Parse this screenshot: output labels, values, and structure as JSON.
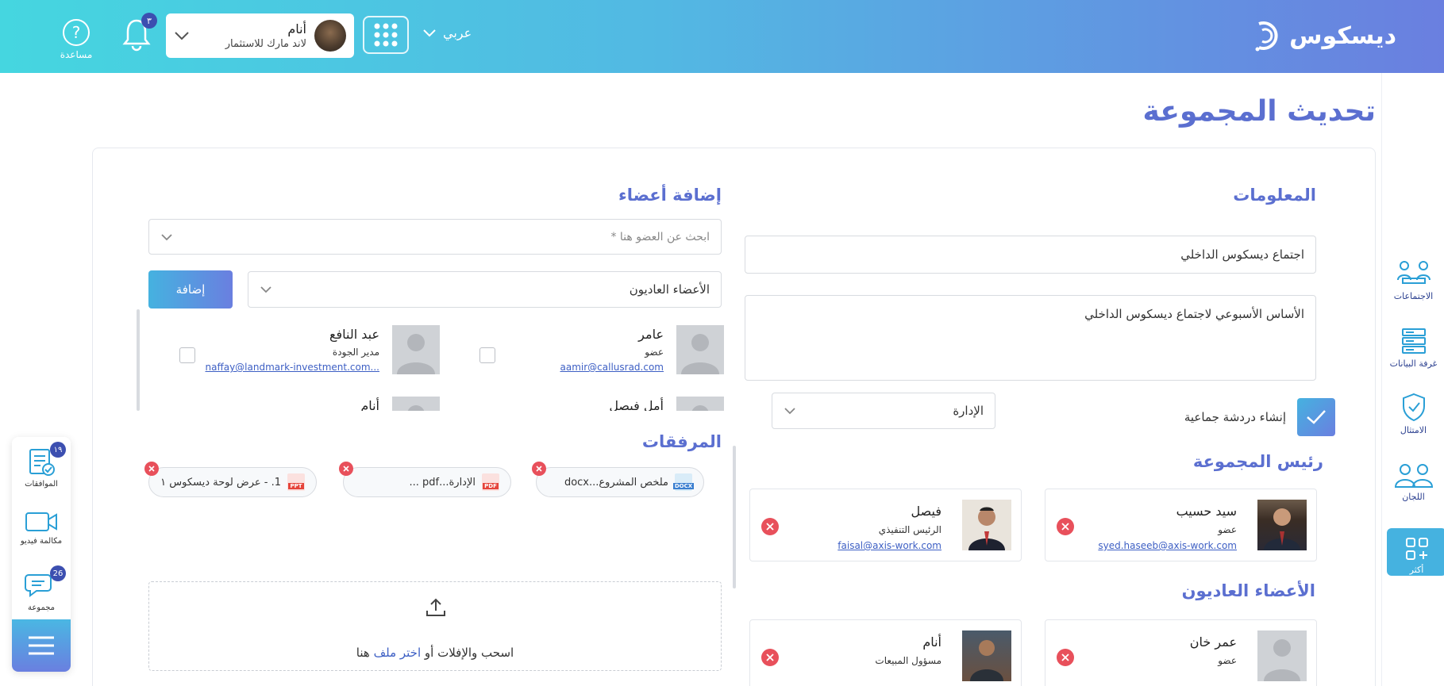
{
  "header": {
    "logo_text": "ديسكوس",
    "language": "عربي",
    "user": {
      "name": "أنام",
      "company": "لاند مارك للاستثمار"
    },
    "notifications_count": "٣",
    "help_label": "مساعدة"
  },
  "right_sidebar": {
    "items": [
      {
        "label": "الاجتماعات",
        "icon": "meetings-icon"
      },
      {
        "label": "غرفة البيانات",
        "icon": "data-room-icon"
      },
      {
        "label": "الامتثال",
        "icon": "compliance-shield-icon"
      },
      {
        "label": "اللجان",
        "icon": "committees-icon"
      },
      {
        "label": "أكثر",
        "icon": "more-grid-icon"
      }
    ]
  },
  "left_panel": {
    "items": [
      {
        "label": "الموافقات",
        "badge": "١٩",
        "icon": "approvals-icon"
      },
      {
        "label": "مكالمة فيديو",
        "icon": "video-call-icon"
      },
      {
        "label": "مجموعة",
        "badge": "26",
        "icon": "group-chat-icon"
      }
    ]
  },
  "page": {
    "title": "تحديث المجموعة"
  },
  "info_section": {
    "title": "المعلومات",
    "group_name": "اجتماع ديسكوس الداخلي",
    "description": "الأساس الأسبوعي لاجتماع ديسكوس الداخلي",
    "create_chat_label": "إنشاء دردشة جماعية",
    "create_chat_checked": true,
    "department_select": "الإدارة"
  },
  "group_head": {
    "title": "رئيس المجموعة",
    "members": [
      {
        "name": "سيد حسيب",
        "role": "عضو",
        "email": "syed.haseeb@axis-work.com"
      },
      {
        "name": "فيصل",
        "role": "الرئيس التنفيذي",
        "email": "faisal@axis-work.com"
      }
    ]
  },
  "regular_members": {
    "title": "الأعضاء العاديون",
    "members": [
      {
        "name": "عمر خان",
        "role": "عضو"
      },
      {
        "name": "أنام",
        "role": "مسؤول المبيعات"
      }
    ]
  },
  "add_members": {
    "title": "إضافة أعضاء",
    "search_placeholder": "ابحث عن العضو هنا *",
    "role_select": "الأعضاء العاديون",
    "add_button": "إضافة",
    "results": [
      {
        "name": "عامر",
        "role": "عضو",
        "email": "aamir@callusrad.com"
      },
      {
        "name": "عبد النافع",
        "role": "مدير الجودة",
        "email": "naffay@landmark-investment.com..."
      },
      {
        "name": "أمل فيصل"
      },
      {
        "name": "أنام"
      }
    ]
  },
  "attachments": {
    "title": "المرفقات",
    "files": [
      {
        "name": "ملخص المشروع...docx",
        "type": "DOCX"
      },
      {
        "name": "الإدارة...pdf ...",
        "type": "PDF"
      },
      {
        "name": "1. - عرض لوحة ديسكوس ١",
        "type": "PPT"
      }
    ],
    "drop_text_prefix": "اسحب والإفلات أو",
    "drop_link": "اختر ملف",
    "drop_text_suffix": "هنا"
  }
}
